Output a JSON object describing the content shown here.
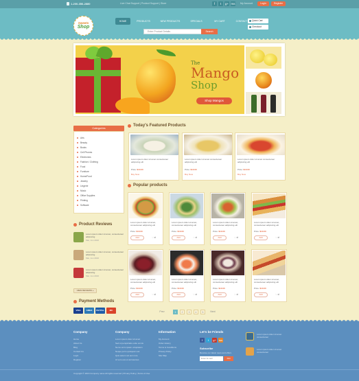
{
  "topbar": {
    "phone": "1-200-356-2880",
    "links": "Live Chat Support  |  Product Support  |  Store",
    "social": [
      "f",
      "t",
      "g+",
      "rss"
    ],
    "my_account": "My Account",
    "login": "Login",
    "register": "Register"
  },
  "header": {
    "logo_top": "Sweets",
    "logo_bottom": "Shop",
    "nav": [
      "HOME",
      "PRODUCTS",
      "NEW PRODUCTS",
      "SPECIALS",
      "MY CART",
      "CONTACT"
    ],
    "search_placeholder": "Enter Product Details",
    "search_button": "Search",
    "cart_items": "Quick Cart",
    "checkout": "Checkout"
  },
  "banner": {
    "title_the": "The",
    "title_mango": "Mango",
    "title_shop": "Shop",
    "button": "Shop Mangos"
  },
  "sidebar": {
    "categories_title": "Categories",
    "categories": [
      "Arts",
      "Beauty",
      "Books",
      "Cell Phones",
      "Electronics",
      "Fashion / Clothing",
      "Food",
      "Furniture",
      "Home/Food",
      "Jewelry",
      "Lingerie",
      "Music",
      "Office Supplies",
      "Printing",
      "Software"
    ],
    "reviews_title": "Product Reviews",
    "reviews": [
      {
        "text": "Lorem ipsum dolor sit amet, consectetuer adipiscing",
        "meta": "Mar, Jun 2016"
      },
      {
        "text": "Lorem ipsum dolor sit amet, consectetuer adipiscing",
        "meta": "Mar, Jun 2016"
      },
      {
        "text": "Lorem ipsum dolor sit amet, consectetuer adipiscing",
        "meta": "Mar, Jun 2016"
      }
    ],
    "view_all": "VIEW REVIEWS »",
    "payments_title": "Payment Methods",
    "payments": [
      "VISA",
      "AMEX",
      "PAYPAL",
      "MC"
    ]
  },
  "featured": {
    "title": "Today's Featured Products",
    "items": [
      {
        "text": "Lorem ipsum dolor sit amet consectetuer adipiscing elit",
        "price_label": "Price:",
        "price": "$10.00",
        "buy": "Buy Now"
      },
      {
        "text": "Lorem ipsum dolor sit amet consectetuer adipiscing elit",
        "price_label": "Price:",
        "price": "$10.00",
        "buy": "Buy Now"
      },
      {
        "text": "Lorem ipsum dolor sit amet consectetuer adipiscing elit",
        "price_label": "Price:",
        "price": "$10.00",
        "buy": "Buy Now"
      }
    ]
  },
  "popular": {
    "title": "Popular products",
    "card_text": "Lorem ipsum dolor sit amet, consectetuer adipiscing elit",
    "price_label": "Price:",
    "price": "$10.00",
    "add": "Add",
    "icons": "♡  ⇄"
  },
  "pager": [
    "1",
    "2",
    "3",
    "4",
    "5"
  ],
  "pager_prev": "Prev",
  "pager_next": "Next",
  "footer": {
    "cols": [
      {
        "title": "Company",
        "links": [
          "Home",
          "About Us",
          "Blog",
          "Contact Us",
          "Login",
          "Register"
        ]
      },
      {
        "title": "Company",
        "links": [
          "Lorem ipsum dolor sit amet",
          "Sed ut perspiciatis unde omnis",
          "Nemo enim ipsam voluptatem",
          "Neque porro quisquam est",
          "Quis autem vel eum iure",
          "At vero eos et accusamus"
        ]
      },
      {
        "title": "Information",
        "links": [
          "My Account",
          "Order History",
          "Terms & Conditions",
          "Privacy Policy",
          "Site Map"
        ]
      }
    ],
    "social_title": "Let's be Friends",
    "subscribe_title": "Subscribe",
    "subscribe_text": "Receive our latest news and offers",
    "email_placeholder": "Enter E-mail",
    "join": "Join",
    "badge_text_1": "Lorem ipsum dolor sit amet consectetuer",
    "badge_text_2": "Lorem ipsum dolor sit amet consectetuer",
    "copyright": "Copyright © 2016 Company name All rights reserved | Privacy Policy | Terms of Use"
  }
}
